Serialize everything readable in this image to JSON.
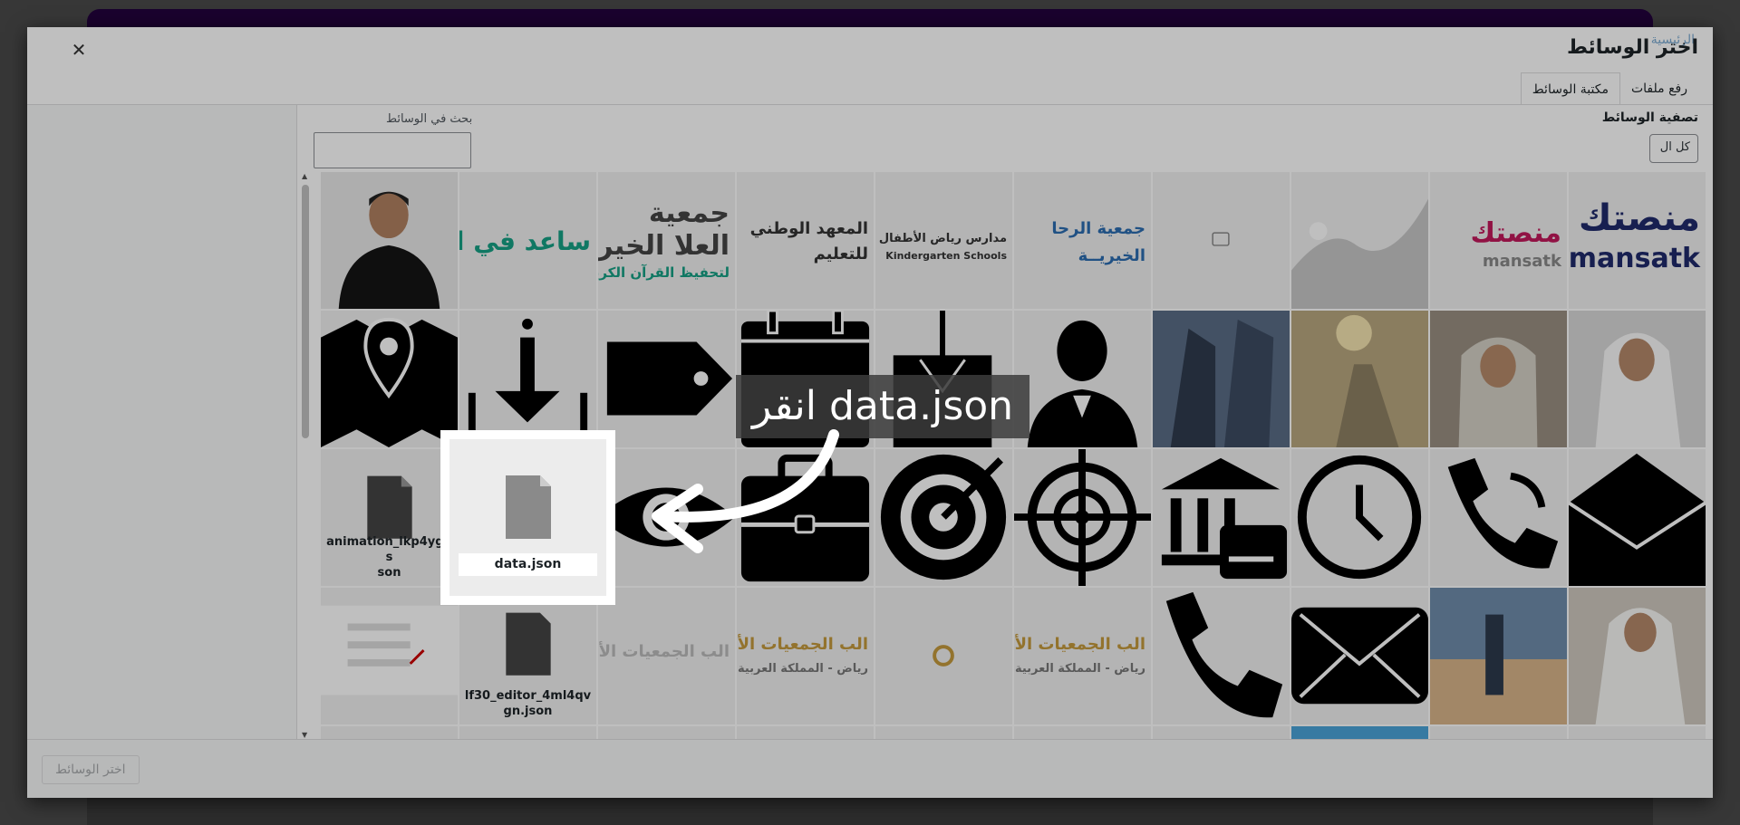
{
  "modal": {
    "title": "اختر الوسائط",
    "title_ghost": "الرئيسية",
    "close_icon": "close-icon",
    "tabs": [
      {
        "label": "رفع ملفات",
        "active": false
      },
      {
        "label": "مكتبة الوسائط",
        "active": true
      }
    ]
  },
  "filters": {
    "label": "تصفية الوسائط",
    "select_value": "كل ال"
  },
  "search": {
    "label": "بحث في الوسائط",
    "placeholder": ""
  },
  "files": {
    "animation": "animation_lkp4ygqsjson",
    "animation_display": "animation_lkp4ygqs\nson",
    "data": "data.json",
    "editor": "lf30_editor_4ml4qvgn.json"
  },
  "logos": {
    "mansatk": "منصتك",
    "mansatk_en": "mansatk",
    "al_ala_1": "جمعية",
    "al_ala_2": "العلا الخير",
    "al_ala_3": "لتحفيظ القرآن الكريم",
    "institute_1": "المعهد الوطني",
    "institute_2": "للتعليم",
    "riyadh_kg": "مدارس رياض الأطفال",
    "riyadh_kg_en": "Kindergarten Schools",
    "rahma_1": "جمعية الرحا",
    "rahma_2": "الخيريــة",
    "saed": "ساعد في ال",
    "assoc_1": "الب الجمعيات الأهلية",
    "assoc_2": "رياض - المملكة العربية"
  },
  "tutorial": {
    "callout": "انقر data.json",
    "highlight_label": "data.json"
  },
  "footer": {
    "select_button": "اختر الوسائط"
  },
  "colors": {
    "brand_header": "#23033d",
    "mansatk_pink": "#c2185b",
    "green_logo": "#16a085",
    "gold": "#c49a3c"
  }
}
